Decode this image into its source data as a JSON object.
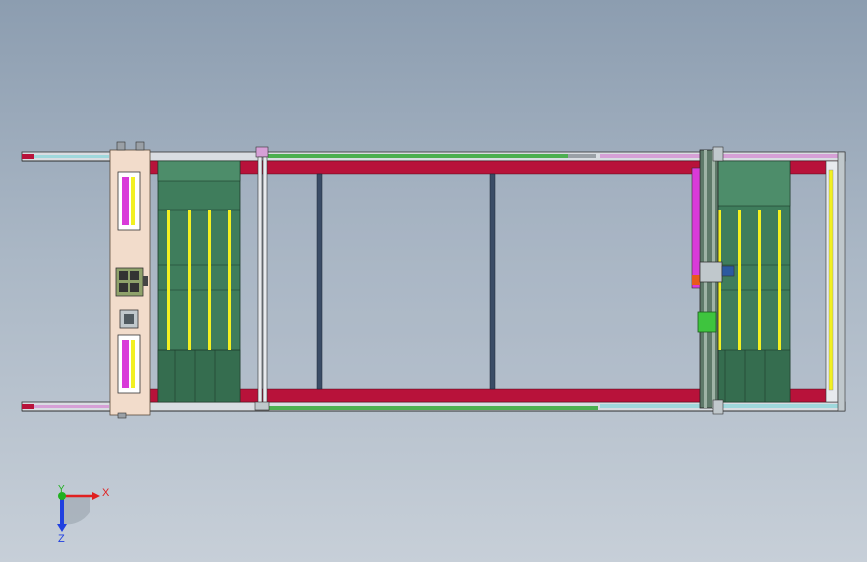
{
  "viewport": {
    "background_top": "#8c9db0",
    "background_bottom": "#c7cfd8"
  },
  "triad": {
    "x_label": "X",
    "y_label": "Y",
    "z_label": "Z",
    "x_color": "#e02020",
    "y_color": "#20b020",
    "z_color": "#2040e0"
  },
  "colors": {
    "frame_red": "#b8123a",
    "pallet_green": "#3f7d5c",
    "rail_yellow": "#f2f022",
    "carriage_beige": "#f2dccb",
    "magenta": "#d93ad9",
    "post_blue": "#3a4c66"
  }
}
